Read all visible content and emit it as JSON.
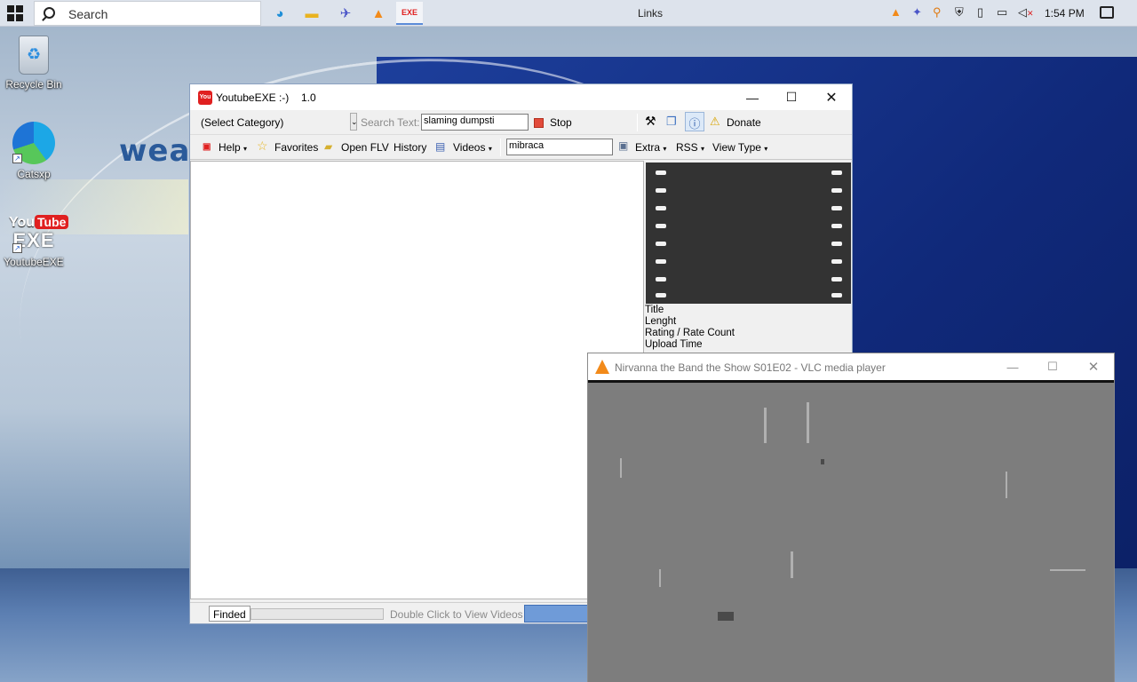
{
  "taskbar": {
    "search_placeholder": "Search",
    "links_label": "Links",
    "clock": "1:54 PM"
  },
  "desktop": {
    "wallpaper_text": "wea",
    "icons": [
      {
        "label": "Recycle Bin"
      },
      {
        "label": "Catsxp"
      },
      {
        "label": "YoutubeEXE"
      }
    ]
  },
  "youtube_exe": {
    "title": "YoutubeEXE  :-)",
    "version": "1.0",
    "category": "(Select Category)",
    "search_label": "Search Text:",
    "search_value": "slaming dumpsti",
    "stop_label": "Stop",
    "donate_label": "Donate",
    "menu": {
      "help": "Help",
      "favorites": "Favorites",
      "open_flv": "Open FLV",
      "history": "History",
      "videos": "Videos",
      "user_value": "mibraca",
      "extra": "Extra",
      "rss": "RSS",
      "view_type": "View Type"
    },
    "info": {
      "title": "Title",
      "length": "Lenght",
      "rating": "Rating / Rate Count",
      "upload": "Upload Time"
    },
    "status": {
      "finded": "Finded",
      "hint": "Double Click to View Videos"
    }
  },
  "vlc": {
    "title": "Nirvanna the Band the Show S01E02 - VLC media player"
  },
  "colors": {
    "accent_blue": "#6f9bd8",
    "vlc_orange": "#f28a1a",
    "youtube_red": "#e02020"
  }
}
